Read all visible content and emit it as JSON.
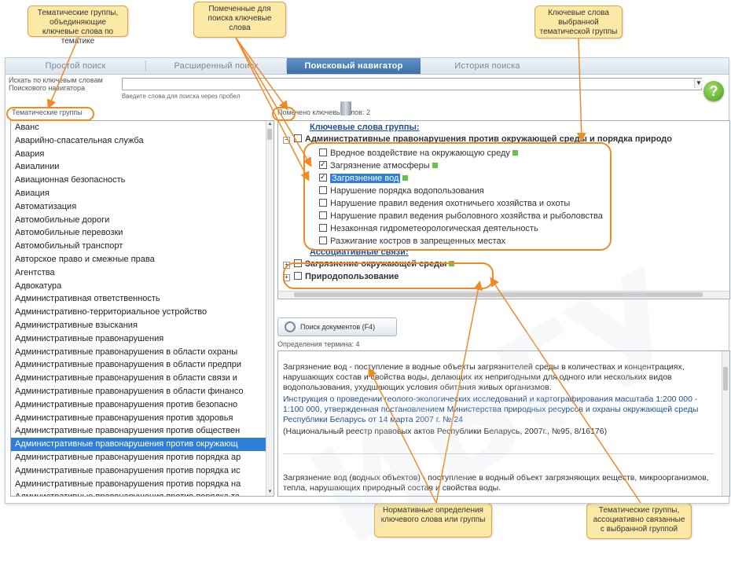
{
  "callouts": {
    "thematic": "Тематические группы, объединяющие ключевые слова по тематике",
    "marked": "Помеченные для поиска ключевые слова",
    "keywords": "Ключевые слова выбранной тематической группы",
    "normative": "Нормативные определения ключевого слова или группы",
    "associated": "Тематические группы, ассоциативно связанные с выбранной группой"
  },
  "tabs": [
    "Простой поиск",
    "Расширенный поиск",
    "Поисковый навигатор",
    "История поиска"
  ],
  "search": {
    "label": "Искать по ключевым словам Поискового навигатора",
    "hint": "Введите слова для поиска через пробел",
    "value": "",
    "help": "?"
  },
  "groups_title": "Тематические группы",
  "marked_label": "Помечено ключевых слов: 2",
  "groups": [
    "Аванс",
    "Аварийно-спасательная служба",
    "Авария",
    "Авиалинии",
    "Авиационная безопасность",
    "Авиация",
    "Автоматизация",
    "Автомобильные дороги",
    "Автомобильные перевозки",
    "Автомобильный транспорт",
    "Авторское право и смежные права",
    "Агентства",
    "Адвокатура",
    "Административная ответственность",
    "Административно-территориальное устройство",
    "Административные взыскания",
    "Административные правонарушения",
    "Административные правонарушения в области охраны",
    "Административные правонарушения в области предпри",
    "Административные правонарушения в области связи и",
    "Административные правонарушения в области финансо",
    "Административные правонарушения против безопасно",
    "Административные правонарушения против здоровья",
    "Административные правонарушения против обществен",
    "Административные правонарушения против окружающ",
    "Административные правонарушения против порядка ар",
    "Административные правонарушения против порядка ис",
    "Административные правонарушения против порядка на",
    "Административные правонарушения против порядка та"
  ],
  "selected_group_index": 24,
  "keywords": {
    "header": "Ключевые слова группы:",
    "group": "Административные правонарушения против окружающей среды и порядка природо",
    "items": [
      {
        "label": "Вредное воздействие на окружающую среду",
        "checked": false,
        "flag": true
      },
      {
        "label": "Загрязнение атмосферы",
        "checked": true,
        "flag": true
      },
      {
        "label": "Загрязнение вод",
        "checked": true,
        "flag": true,
        "highlight": true
      },
      {
        "label": "Нарушение порядка водопользования",
        "checked": false,
        "flag": false
      },
      {
        "label": "Нарушение правил ведения охотничьего хозяйства и охоты",
        "checked": false,
        "flag": false
      },
      {
        "label": "Нарушение правил ведения рыболовного хозяйства и рыболовства",
        "checked": false,
        "flag": false
      },
      {
        "label": "Незаконная гидрометеорологическая деятельность",
        "checked": false,
        "flag": false
      },
      {
        "label": "Разжигание костров в запрещенных местах",
        "checked": false,
        "flag": false
      }
    ],
    "assoc_header": "Ассоциативные связи:",
    "assoc": [
      "Загрязнение окружающей среды",
      "Природопользование"
    ]
  },
  "search_docs_button": "Поиск документов (F4)",
  "definitions_count": "Определения термина: 4",
  "definitions": {
    "d1_text": "Загрязнение вод - поступление в водные объекты загрязнителей среды в количествах и концентрациях, нарушающих состав и свойства воды, делающих их непригодными для одного или нескольких видов водопользования, ухудшающих условия обитания живых организмов.",
    "d1_link": "Инструкция о проведении геолого-экологических исследований и картографирования масштаба 1:200 000 - 1:100 000, утвержденная постановлением Министерства природных ресурсов и охраны окружающей среды Республики Беларусь от 14 марта 2007 г. № 24",
    "d1_src": "(Национальный реестр правовых актов Республики Беларусь, 2007г., №95, 8/16176)",
    "d2_text": "Загрязнение вод (водных объектов) - поступление в водный объект загрязняющих веществ, микроорганизмов, тепла, нарушающих природный состав и свойства воды."
  }
}
